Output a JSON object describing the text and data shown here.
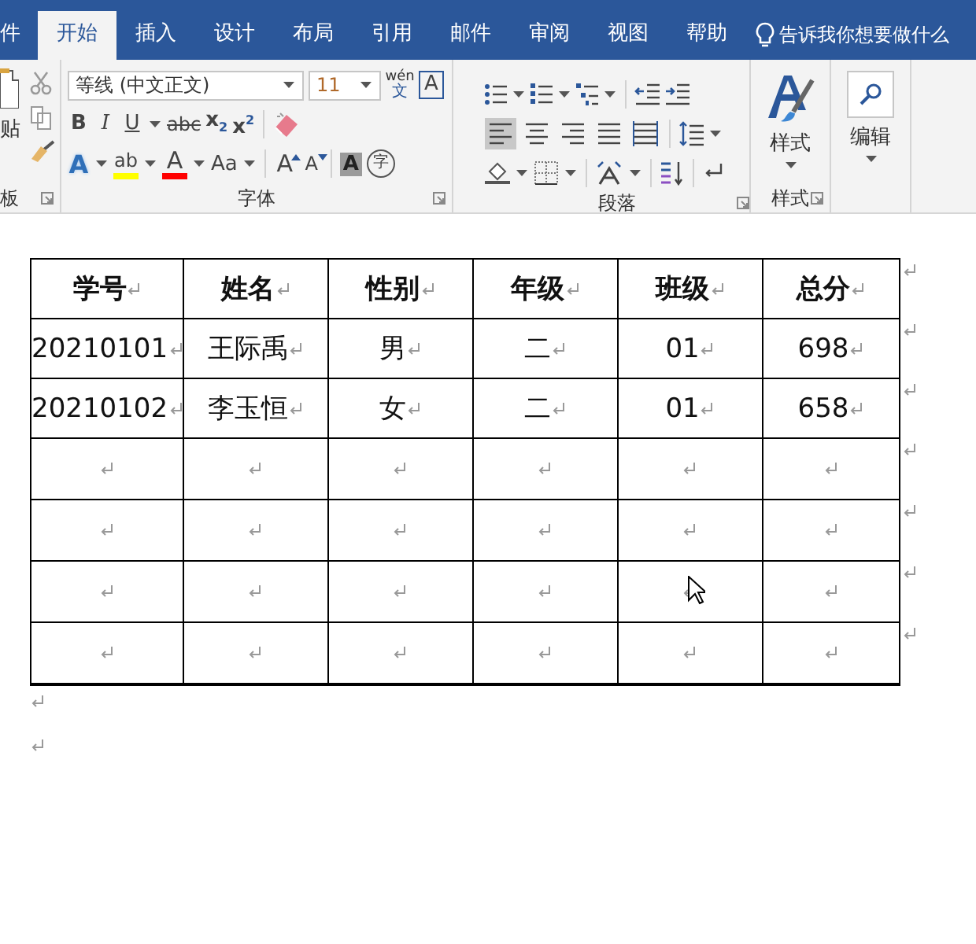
{
  "tabs": [
    {
      "label": "件",
      "selected": false
    },
    {
      "label": "开始",
      "selected": true
    },
    {
      "label": "插入",
      "selected": false
    },
    {
      "label": "设计",
      "selected": false
    },
    {
      "label": "布局",
      "selected": false
    },
    {
      "label": "引用",
      "selected": false
    },
    {
      "label": "邮件",
      "selected": false
    },
    {
      "label": "审阅",
      "selected": false
    },
    {
      "label": "视图",
      "selected": false
    },
    {
      "label": "帮助",
      "selected": false
    }
  ],
  "tell_me": "告诉我你想要做什么",
  "clipboard": {
    "paste_label": "贴",
    "group_label": "板"
  },
  "font": {
    "group_label": "字体",
    "font_name": "等线 (中文正文)",
    "font_size": "11",
    "top_tools": [
      {
        "kind": "phonetic",
        "text": "wén",
        "sub": "文"
      },
      {
        "kind": "boxed",
        "text": "A"
      }
    ],
    "row2": [
      {
        "kind": "bold",
        "text": "B"
      },
      {
        "kind": "italic",
        "text": "I"
      },
      {
        "kind": "underline",
        "text": "U"
      },
      {
        "kind": "strike",
        "text": "abc"
      },
      {
        "kind": "sub",
        "text": "x$_{2}$"
      },
      {
        "kind": "sup",
        "text": "x$^{2}$"
      }
    ],
    "row3": [
      {
        "kind": "effects",
        "text": "A"
      },
      {
        "kind": "highlight",
        "text": "ab",
        "color": "#ffff00"
      },
      {
        "kind": "fontcolor",
        "text": "A",
        "color": "#ff0000"
      },
      {
        "kind": "case",
        "text": "Aa"
      },
      {
        "kind": "grow",
        "text": "A"
      },
      {
        "kind": "shrink",
        "text": "A"
      },
      {
        "kind": "shade",
        "text": "A"
      },
      {
        "kind": "enclose",
        "text": "字"
      }
    ]
  },
  "paragraph": {
    "group_label": "段落",
    "alignment": [
      {
        "kind": "left",
        "selected": true
      },
      {
        "kind": "center",
        "selected": false
      },
      {
        "kind": "right",
        "selected": false
      },
      {
        "kind": "justify",
        "selected": false
      },
      {
        "kind": "distributed",
        "selected": false
      }
    ]
  },
  "styles": {
    "label": "样式",
    "group_label": "样式"
  },
  "editing": {
    "label": "编辑"
  },
  "table": {
    "header": [
      "学号",
      "姓名",
      "性别",
      "年级",
      "班级",
      "总分"
    ],
    "rows": [
      {
        "kind": "data",
        "cells": [
          "20210101",
          "王际禹",
          "男",
          "二",
          "01",
          "698"
        ]
      },
      {
        "kind": "data",
        "cells": [
          "20210102",
          "李玉恒",
          "女",
          "二",
          "01",
          "658"
        ]
      },
      {
        "kind": "empty"
      },
      {
        "kind": "empty"
      },
      {
        "kind": "empty"
      },
      {
        "kind": "empty"
      }
    ]
  }
}
